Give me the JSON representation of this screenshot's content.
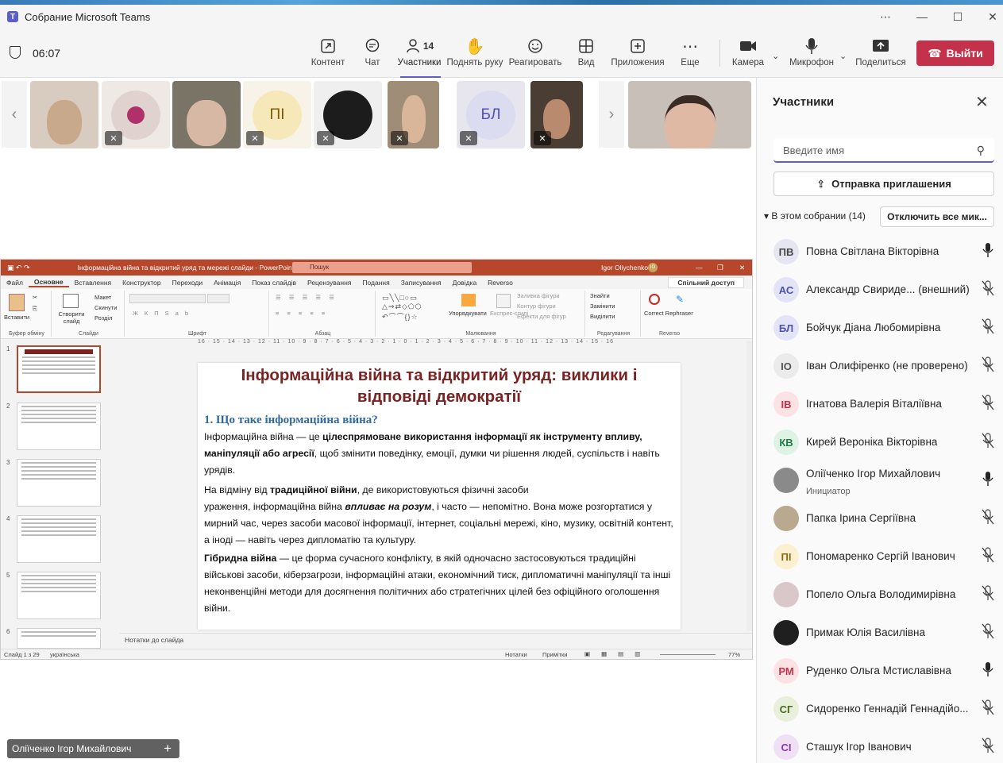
{
  "window": {
    "title": "Собрание Microsoft Teams"
  },
  "meeting": {
    "timer": "06:07",
    "participants_count": "14",
    "toolbar": {
      "content": "Контент",
      "chat": "Чат",
      "participants": "Участники",
      "raise_hand": "Поднять руку",
      "react": "Реагировать",
      "view": "Вид",
      "apps": "Приложения",
      "more": "Еще",
      "camera": "Камера",
      "mic": "Микрофон",
      "share": "Поделиться",
      "leave": "Выйти"
    },
    "gallery": [
      {
        "initials": ""
      },
      {
        "initials": ""
      },
      {
        "initials": ""
      },
      {
        "initials": "ПІ"
      },
      {
        "initials": ""
      },
      {
        "initials": ""
      },
      {
        "initials": "БЛ"
      },
      {
        "initials": ""
      }
    ],
    "presenter_label": "Оліїченко Ігор Михайлович"
  },
  "ppt": {
    "title": "Інформаційна війна та відкритий уряд та мережі слайди - PowerPoint",
    "search": "Пошук",
    "user": "Igor Oliychenko",
    "user_initials": "IO",
    "tabs": [
      "Файл",
      "Основне",
      "Вставлення",
      "Конструктор",
      "Переходи",
      "Анімація",
      "Показ слайдів",
      "Рецензування",
      "Подання",
      "Записування",
      "Довідка",
      "Reverso"
    ],
    "share_label": "Спільний доступ",
    "ribbon": {
      "paste": "Вставити",
      "clipboard": "Буфер обміну",
      "new_slide": "Створити слайд",
      "layout": "Макет",
      "reset": "Скинути",
      "section": "Розділ",
      "slides": "Слайди",
      "font": "Шрифт",
      "paragraph": "Абзац",
      "arrange": "Упорядкувати",
      "quick_styles": "Експрес-стилі",
      "fill": "Заливка фігури",
      "outline": "Контур фігури",
      "effects": "Ефекти для фігур",
      "drawing": "Малювання",
      "find": "Знайти",
      "replace": "Замінити",
      "select": "Виділити",
      "editing": "Редагування",
      "rephraser": "Correct Rephraser",
      "reverso": "Reverso"
    },
    "ruler": "16 · 15 · 14 · 13 · 12 · 11 · 10 · 9 · 8 · 7 · 6 · 5 · 4 · 3 · 2 · 1 · 0 · 1 · 2 · 3 · 4 · 5 · 6 · 7 · 8 · 9 · 10 · 11 · 12 · 13 · 14 · 15 · 16",
    "thumbnails": [
      "1",
      "2",
      "3",
      "4",
      "5",
      "6"
    ],
    "slide": {
      "title": "Інформаційна війна та відкритий уряд: виклики і відповіді демократії",
      "heading": "1. Що таке інформаційна війна?",
      "p1_a": "Інформаційна війна — це ",
      "p1_b": "цілеспрямоване використання інформації як інструменту впливу, маніпуляції або агресії",
      "p1_c": ", щоб змінити поведінку, емоції, думки чи рішення людей, суспільств і навіть урядів.",
      "p2_a": "На відміну від ",
      "p2_b": "традиційної війни",
      "p2_c": ", де використовуються фізичні засоби",
      "p2_d": "ураження, інформаційна війна ",
      "p2_e": "впливає на розум",
      "p2_f": ", і часто — непомітно. Вона може розгортатися у мирний час, через засоби масової інформації, інтернет, соціальні мережі, кіно, музику, освітній контент, а іноді — навіть через дипломатію та культуру.",
      "p3_a": "Гібридна війна",
      "p3_b": " — це форма сучасного конфлікту, в якій одночасно застосовуються традиційні військові засоби, кіберзагрози, інформаційні атаки, економічний тиск, дипломатичні маніпуляції та інші неконвенційні методи для досягнення політичних або стратегічних цілей без офіційного оголошення війни."
    },
    "notes": "Нотатки до слайда",
    "status": {
      "slide": "Слайд 1 з 29",
      "lang": "українська",
      "notes": "Нотатки",
      "comments": "Примітки",
      "zoom": "77%"
    }
  },
  "panel": {
    "title": "Участники",
    "search_placeholder": "Введите имя",
    "invite": "Отправка приглашения",
    "section": "В этом собрании (14)",
    "mute_all": "Отключить все мик...",
    "people": [
      {
        "initials": "ПВ",
        "name": "Повна Світлана Вікторівна",
        "sub": "",
        "mic": "on",
        "color": "#e6e6f2",
        "fg": "#444"
      },
      {
        "initials": "АС",
        "name": "Александр Свириде... (внешний)",
        "sub": "",
        "mic": "off",
        "color": "#e3e4f7",
        "fg": "#4f52b2"
      },
      {
        "initials": "БЛ",
        "name": "Бойчук Діана Любомирівна",
        "sub": "",
        "mic": "off",
        "color": "#e3e4f7",
        "fg": "#4f52b2"
      },
      {
        "initials": "ІО",
        "name": "Іван Олифіренко (не проверено)",
        "sub": "",
        "mic": "off",
        "color": "#ebebeb",
        "fg": "#555"
      },
      {
        "initials": "ІВ",
        "name": "Ігнатова Валерія Віталіївна",
        "sub": "",
        "mic": "off",
        "color": "#fde2e4",
        "fg": "#c4314b"
      },
      {
        "initials": "КВ",
        "name": "Кирей Вероніка Вікторівна",
        "sub": "",
        "mic": "off",
        "color": "#dff3e5",
        "fg": "#237b4b"
      },
      {
        "initials": "",
        "name": "Оліїченко Ігор Михайлович",
        "sub": "Инициатор",
        "mic": "on",
        "color": "#8a8a8a",
        "fg": "#fff"
      },
      {
        "initials": "",
        "name": "Папка Ірина Сергіївна",
        "sub": "",
        "mic": "off",
        "color": "#b9a98e",
        "fg": "#fff"
      },
      {
        "initials": "ПІ",
        "name": "Пономаренко Сергій Іванович",
        "sub": "",
        "mic": "off",
        "color": "#fbf1d0",
        "fg": "#8a6a10"
      },
      {
        "initials": "",
        "name": "Попело Ольга Володимирівна",
        "sub": "",
        "mic": "off",
        "color": "#d9c7c9",
        "fg": "#fff"
      },
      {
        "initials": "",
        "name": "Примак Юлія Василівна",
        "sub": "",
        "mic": "off",
        "color": "#1f1f1f",
        "fg": "#fff"
      },
      {
        "initials": "РМ",
        "name": "Руденко Ольга Мстиславівна",
        "sub": "",
        "mic": "on",
        "color": "#fde2e4",
        "fg": "#c4314b"
      },
      {
        "initials": "СГ",
        "name": "Сидоренко Геннадій Геннадійо...",
        "sub": "",
        "mic": "off",
        "color": "#e8f0dc",
        "fg": "#4a6b1f"
      },
      {
        "initials": "СІ",
        "name": "Сташук Ігор Іванович",
        "sub": "",
        "mic": "off",
        "color": "#efe0f6",
        "fg": "#8a3ab0"
      }
    ]
  },
  "colors": {
    "accent": "#5b5fc7",
    "leave": "#c4314b",
    "ppt": "#b7472a"
  }
}
